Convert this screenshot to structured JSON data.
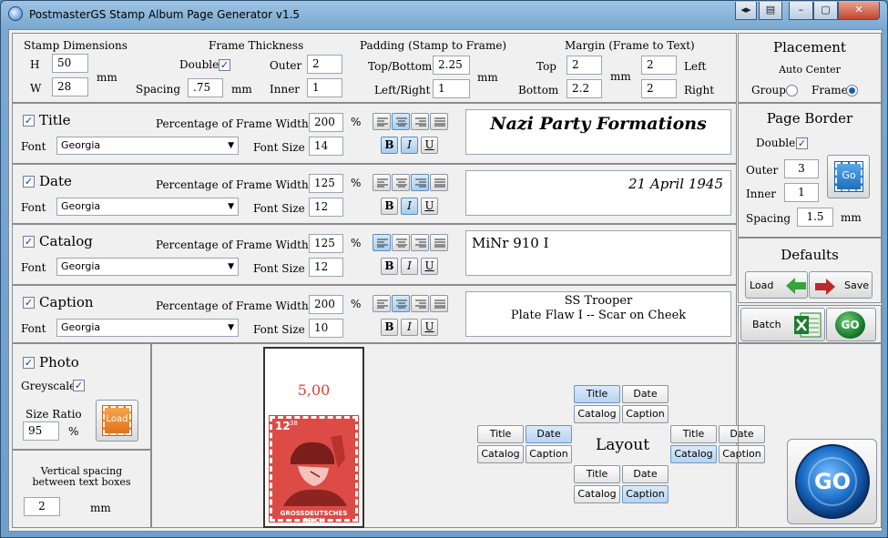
{
  "window": {
    "title": "PostmasterGS Stamp Album Page Generator v1.5"
  },
  "stamp_dimensions": {
    "label": "Stamp Dimensions",
    "h_label": "H",
    "h": "50",
    "w_label": "W",
    "w": "28",
    "unit": "mm"
  },
  "frame_thickness": {
    "label": "Frame Thickness",
    "double_label": "Double",
    "double": true,
    "spacing_label": "Spacing",
    "spacing": ".75",
    "spacing_unit": "mm",
    "outer_label": "Outer",
    "outer": "2",
    "inner_label": "Inner",
    "inner": "1"
  },
  "padding": {
    "label": "Padding (Stamp to Frame)",
    "top_bottom_label": "Top/Bottom",
    "top_bottom": "2.25",
    "left_right_label": "Left/Right",
    "left_right": "1",
    "unit": "mm"
  },
  "margin": {
    "label": "Margin (Frame to Text)",
    "top_label": "Top",
    "top": "2",
    "bottom_label": "Bottom",
    "bottom": "2.2",
    "unit": "mm",
    "left": "2",
    "left_label": "Left",
    "right": "2",
    "right_label": "Right"
  },
  "common": {
    "pct_label": "Percentage of Frame Width",
    "pct_unit": "%",
    "font_label": "Font",
    "font_size_label": "Font Size",
    "bold": "B",
    "italic": "I",
    "underline": "U"
  },
  "rows": [
    {
      "name": "Title",
      "checked": true,
      "pct": "200",
      "font": "Georgia",
      "font_size": "14",
      "preview": "Nazi Party Formations"
    },
    {
      "name": "Date",
      "checked": true,
      "pct": "125",
      "font": "Georgia",
      "font_size": "12",
      "preview": "21 April 1945"
    },
    {
      "name": "Catalog",
      "checked": true,
      "pct": "125",
      "font": "Georgia",
      "font_size": "12",
      "preview": "MiNr 910 I"
    },
    {
      "name": "Caption",
      "checked": true,
      "pct": "200",
      "font": "Georgia",
      "font_size": "10",
      "preview_line1": "SS Trooper",
      "preview_line2": "Plate Flaw I -- Scar on Cheek"
    }
  ],
  "placement": {
    "title": "Placement",
    "auto_center": "Auto Center",
    "group_label": "Group",
    "frame_label": "Frame",
    "selected": "Frame"
  },
  "page_border": {
    "title": "Page Border",
    "double_label": "Double",
    "double": true,
    "outer_label": "Outer",
    "outer": "3",
    "inner_label": "Inner",
    "inner": "1",
    "spacing_label": "Spacing",
    "spacing": "1.5",
    "unit": "mm",
    "go": "Go"
  },
  "defaults": {
    "title": "Defaults",
    "load": "Load",
    "save": "Save"
  },
  "batch": {
    "label": "Batch",
    "go": "GO"
  },
  "photo": {
    "label": "Photo",
    "checked": true,
    "greyscale_label": "Greyscale",
    "greyscale": true,
    "size_ratio_label": "Size Ratio",
    "size_ratio": "95",
    "size_unit": "%",
    "load": "Load"
  },
  "vertical_spacing": {
    "label_line1": "Vertical spacing",
    "label_line2": "between text boxes",
    "value": "2",
    "unit": "mm"
  },
  "stamp": {
    "value": "5,00",
    "denomination": "12",
    "denom_small": "38",
    "inscription": "GROSSDEUTSCHES REICH"
  },
  "layout": {
    "label": "Layout",
    "title": "Title",
    "date": "Date",
    "catalog": "Catalog",
    "caption": "Caption"
  },
  "go_big": "GO",
  "colors": {
    "accent": "#3c7fc4",
    "stamp_red": "#d9403a",
    "selected": "#b6d3f1"
  }
}
